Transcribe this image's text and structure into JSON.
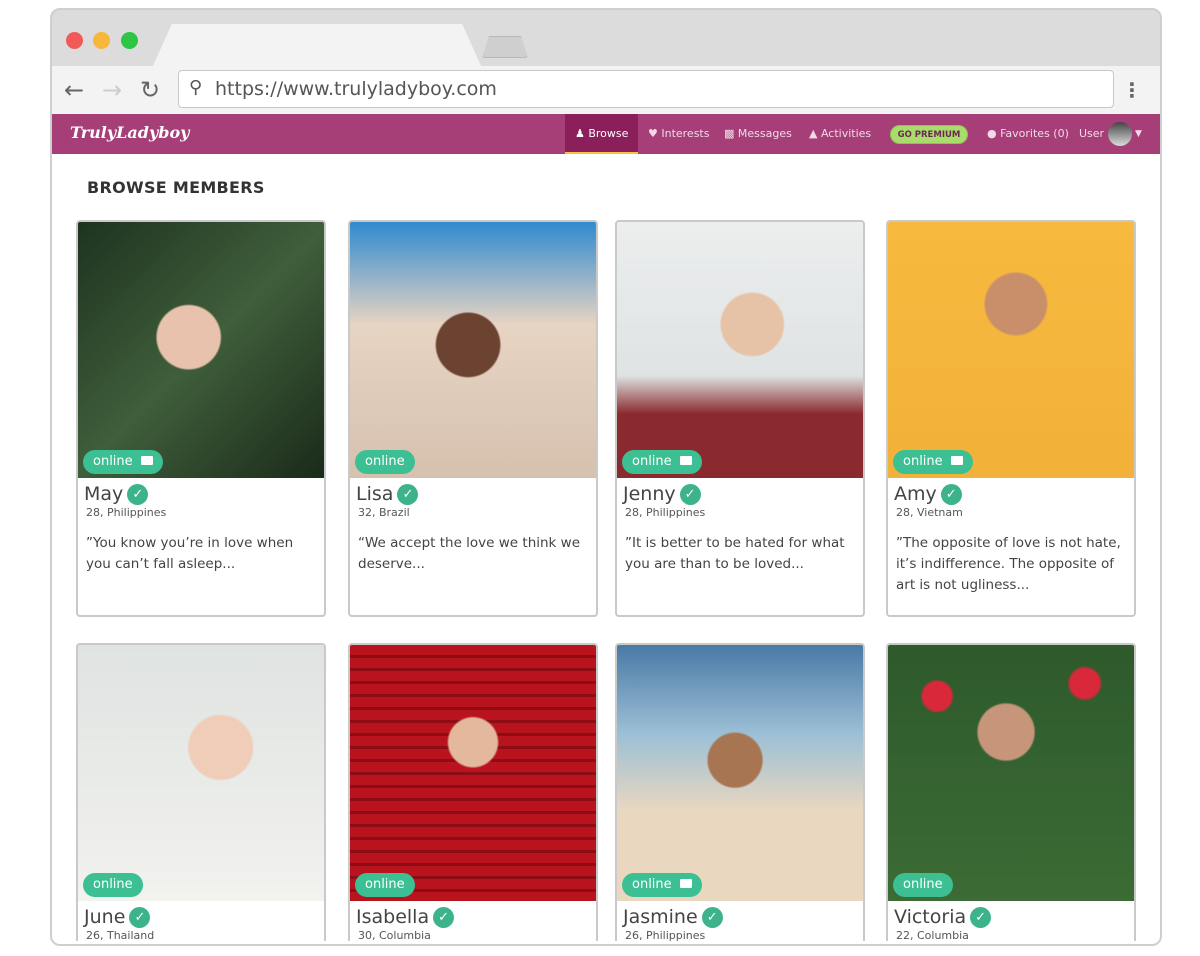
{
  "browser": {
    "url": "https://www.trulyladyboy.com"
  },
  "nav": {
    "logo": "TrulyLadyboy",
    "items": [
      {
        "label": "Browse",
        "icon": "users-icon",
        "active": true
      },
      {
        "label": "Interests",
        "icon": "heart-icon"
      },
      {
        "label": "Messages",
        "icon": "chat-icon"
      },
      {
        "label": "Activities",
        "icon": "bell-icon"
      }
    ],
    "premium": "GO PREMIUM",
    "favorites": "Favorites (0)",
    "user": "User"
  },
  "page": {
    "title": "BROWSE MEMBERS"
  },
  "colors": {
    "brand": "#a63f78",
    "online": "#3cbf93",
    "premium": "#a8dc6b"
  },
  "members": [
    {
      "name": "May",
      "meta": "28, Philippines",
      "quote": "”You know you’re in love when you can’t fall asleep...",
      "status": "online",
      "video": true
    },
    {
      "name": "Lisa",
      "meta": "32, Brazil",
      "quote": "“We accept the love we think we deserve...",
      "status": "online",
      "video": false
    },
    {
      "name": "Jenny",
      "meta": "28, Philippines",
      "quote": "”It is better to be hated for what you are than to be loved...",
      "status": "online",
      "video": true
    },
    {
      "name": "Amy",
      "meta": "28, Vietnam",
      "quote": "”The opposite of love is not hate, it’s indifference. The opposite of art is not ugliness...",
      "status": "online",
      "video": true
    },
    {
      "name": "June",
      "meta": "26, Thailand",
      "quote": "",
      "status": "online",
      "video": false
    },
    {
      "name": "Isabella",
      "meta": "30, Columbia",
      "quote": "",
      "status": "online",
      "video": false
    },
    {
      "name": "Jasmine",
      "meta": "26, Philippines",
      "quote": "",
      "status": "online",
      "video": true
    },
    {
      "name": "Victoria",
      "meta": "22, Columbia",
      "quote": "",
      "status": "online",
      "video": false
    }
  ]
}
